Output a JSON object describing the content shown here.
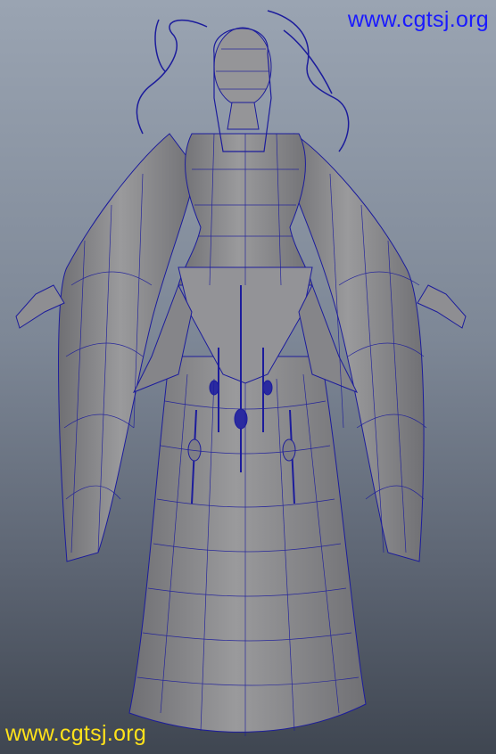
{
  "watermarks": {
    "top_right": "www.cgtsj.org",
    "bottom_left": "www.cgtsj.org"
  },
  "colors": {
    "background_top": "#9aa4b2",
    "background_bottom": "#3f4651",
    "mesh_fill": "#8a8a8a",
    "wireframe": "#1c1c9c",
    "watermark_top": "#1a1aff",
    "watermark_bottom": "#ffe21a"
  },
  "scene": {
    "subject": "wireframe-female-character-model"
  }
}
